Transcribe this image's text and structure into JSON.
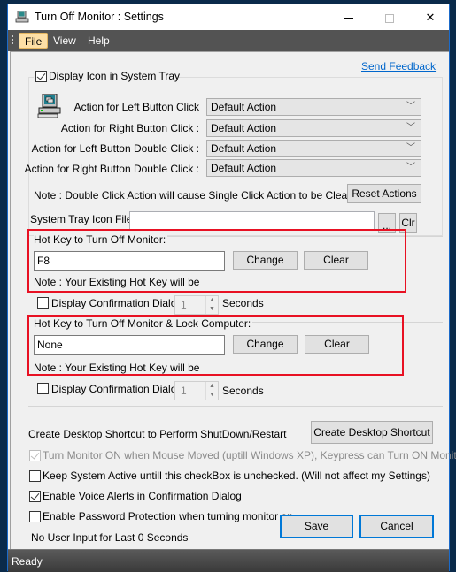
{
  "window": {
    "title": "Turn Off Monitor : Settings",
    "controls": {
      "minimize": "minimize",
      "maximize": "maximize",
      "close": "✕"
    }
  },
  "menu": {
    "items": [
      "File",
      "View",
      "Help"
    ]
  },
  "send_feedback": "Send Feedback",
  "tray": {
    "display_icon_label": "Display Icon in System Tray",
    "display_icon_checked": true,
    "actions": [
      {
        "label": "Action for Left Button Click",
        "value": "Default Action"
      },
      {
        "label": "Action for Right Button Click :",
        "value": "Default Action"
      },
      {
        "label": "Action for Left Button Double Click :",
        "value": "Default Action"
      },
      {
        "label": "Action for Right Button Double Click :",
        "value": "Default Action"
      }
    ],
    "note": "Note : Double Click Action will cause Single Click Action to be Cleared",
    "reset_button": "Reset Actions",
    "icon_file_label": "System Tray Icon File",
    "icon_file_value": "",
    "browse_button": "...",
    "clear_button": "Clr"
  },
  "hotkey1": {
    "title": "Hot Key to Turn Off Monitor:",
    "value": "F8",
    "change_button": "Change",
    "clear_button": "Clear",
    "note": "Note : Your Existing Hot Key will be",
    "confirm_label": "Display Confirmation Dialog",
    "confirm_checked": false,
    "seconds_value": "1",
    "seconds_label": "Seconds"
  },
  "hotkey2": {
    "title": "Hot Key to Turn Off Monitor & Lock Computer:",
    "value": "None",
    "change_button": "Change",
    "clear_button": "Clear",
    "note": "Note : Your Existing Hot Key will be",
    "confirm_label": "Display Confirmation Dialog",
    "confirm_checked": false,
    "seconds_value": "1",
    "seconds_label": "Seconds"
  },
  "shortcut": {
    "label": "Create Desktop Shortcut to Perform ShutDown/Restart",
    "button": "Create Desktop Shortcut"
  },
  "options": {
    "mouse_move": {
      "label": "Turn Monitor ON when Mouse Moved (uptill Windows XP), Keypress can Turn ON Monitor",
      "checked": true,
      "disabled": true
    },
    "keep_active": {
      "label": "Keep System Active untill this checkBox is unchecked.  (Will not affect my Settings)",
      "checked": false
    },
    "voice_alerts": {
      "label": "Enable Voice Alerts in Confirmation Dialog",
      "checked": true
    },
    "password": {
      "label": "Enable Password Protection when turning monitor on",
      "checked": false
    }
  },
  "idle_text": "No User Input for Last 0 Seconds",
  "buttons": {
    "save": "Save",
    "cancel": "Cancel"
  },
  "status": "Ready"
}
